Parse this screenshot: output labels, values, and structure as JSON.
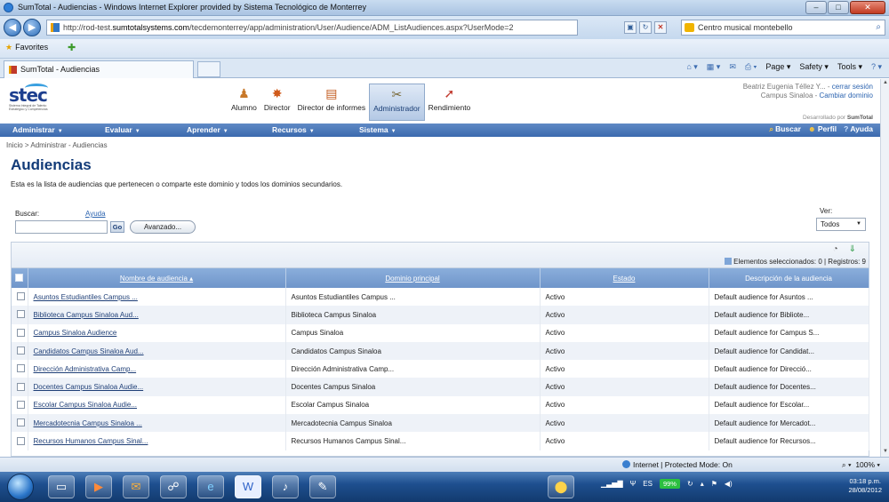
{
  "window": {
    "title": "SumTotal - Audiencias - Windows Internet Explorer provided by Sistema Tecnológico de Monterrey",
    "url_prefix": "http://rod-test.",
    "url_host": "sumtotalsystems.com",
    "url_path": "/tecdemonterrey/app/administration/User/Audience/ADM_ListAudiences.aspx?UserMode=2",
    "search_text": "Centro musical montebello",
    "favorites_label": "Favorites",
    "tab_title": "SumTotal - Audiencias",
    "commands": [
      "Page ▾",
      "Safety ▾",
      "Tools ▾"
    ]
  },
  "header": {
    "roles": [
      {
        "label": "Alumno",
        "icon": "student-icon"
      },
      {
        "label": "Director",
        "icon": "director-icon"
      },
      {
        "label": "Director de informes",
        "icon": "report-icon"
      },
      {
        "label": "Administrador",
        "icon": "tools-icon"
      },
      {
        "label": "Rendimiento",
        "icon": "runner-icon"
      }
    ],
    "user_name": "Beatriz Eugenia Téllez Y...",
    "logout_link": "cerrar sesión",
    "domain_name": "Campus Sinaloa",
    "change_domain_link": "Cambiar dominio",
    "powered_by_prefix": "Desarrollado por",
    "powered_by_brand": "SumTotal"
  },
  "nav": {
    "items": [
      "Administrar",
      "Evaluar",
      "Aprender",
      "Recursos",
      "Sistema"
    ],
    "right": [
      "Buscar",
      "Perfil",
      "Ayuda"
    ]
  },
  "breadcrumb": "Inicio > Administrar - Audiencias",
  "page": {
    "title": "Audiencias",
    "description": "Esta es la lista de audiencias que pertenecen o comparte este dominio y todos los dominios secundarios."
  },
  "search": {
    "label": "Buscar:",
    "help": "Ayuda",
    "go": "Go",
    "advanced": "Avanzado..."
  },
  "view": {
    "label": "Ver:",
    "selected": "Todos"
  },
  "grid": {
    "selection_summary": "Elementos seleccionados: 0 | Registros: 9",
    "columns": [
      "Nombre de audiencia ▴",
      "Dominio principal",
      "Estado",
      "Descripción de la audiencia"
    ],
    "rows": [
      [
        "Asuntos Estudiantiles Campus ...",
        "Asuntos Estudiantiles Campus ...",
        "Activo",
        "Default audience for Asuntos ..."
      ],
      [
        "Biblioteca Campus Sinaloa Aud...",
        "Biblioteca Campus Sinaloa",
        "Activo",
        "Default audience for Bibliote..."
      ],
      [
        "Campus Sinaloa Audience",
        "Campus Sinaloa",
        "Activo",
        "Default audience for Campus S..."
      ],
      [
        "Candidatos Campus Sinaloa Aud...",
        "Candidatos Campus Sinaloa",
        "Activo",
        "Default audience for Candidat..."
      ],
      [
        "Dirección Administrativa Camp...",
        "Dirección Administrativa Camp...",
        "Activo",
        "Default audience for Direcció..."
      ],
      [
        "Docentes Campus Sinaloa Audie...",
        "Docentes Campus Sinaloa",
        "Activo",
        "Default audience for Docentes..."
      ],
      [
        "Escolar Campus Sinaloa Audie...",
        "Escolar Campus Sinaloa",
        "Activo",
        "Default audience for Escolar..."
      ],
      [
        "Mercadotecnia Campus Sinaloa ...",
        "Mercadotecnia Campus Sinaloa",
        "Activo",
        "Default audience for Mercadot..."
      ],
      [
        "Recursos Humanos Campus Sinal...",
        "Recursos Humanos Campus Sinal...",
        "Activo",
        "Default audience for Recursos..."
      ]
    ]
  },
  "statusbar": {
    "zone": "Internet | Protected Mode: On",
    "zoom": "100%"
  },
  "taskbar": {
    "language": "ES",
    "battery": "99%",
    "time": "03:18 p.m.",
    "date": "28/08/2012"
  }
}
